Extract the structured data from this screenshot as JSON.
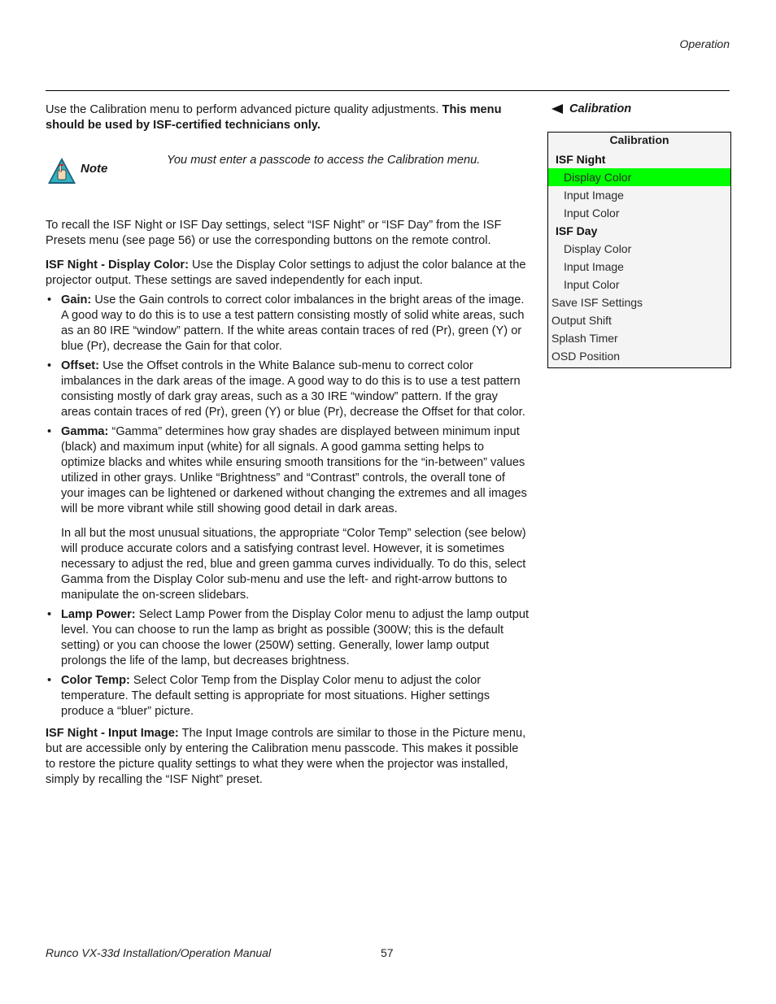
{
  "header": {
    "section": "Operation"
  },
  "intro": {
    "text": "Use the Calibration menu to perform advanced picture quality adjustments. ",
    "bold": "This menu should be used by ISF-certified technicians only."
  },
  "note": {
    "icon": "warning-hand-icon",
    "label": "Note",
    "text": "You must enter a passcode to access the Calibration menu."
  },
  "paragraphs": {
    "recall": "To recall the ISF Night or ISF Day settings, select “ISF Night” or “ISF Day” from the ISF Presets menu (see page 56) or use the corresponding buttons on the remote control.",
    "display_color": {
      "bold": "ISF Night - Display Color:",
      "text": " Use the Display Color settings to adjust the color balance at the projector output. These settings are saved independently for each input."
    },
    "input_image": {
      "bold": "ISF Night - Input Image:",
      "text": " The Input Image controls are similar to those in the Picture menu, but are accessible only by entering the Calibration menu passcode. This makes it possible to restore the picture quality settings to what they were when the projector was installed, simply by recalling the “ISF Night” preset."
    }
  },
  "bullets": [
    {
      "bold": "Gain:",
      "text": " Use the Gain controls to correct color imbalances in the bright areas of the image. A good way to do this is to use a test pattern consisting mostly of solid white areas, such as an 80 IRE “window” pattern. If the white areas contain traces of red (Pr), green (Y) or blue (Pr), decrease the Gain for that color."
    },
    {
      "bold": "Offset:",
      "text": " Use the Offset controls in the White Balance sub-menu to correct color imbalances in the dark areas of the image. A good way to do this is to use a test pattern consisting mostly of dark gray areas, such as a 30 IRE “window” pattern. If the gray areas contain traces of red (Pr), green (Y) or blue (Pr), decrease the Offset for that color."
    },
    {
      "bold": "Gamma:",
      "text": " “Gamma” determines how gray shades are displayed between minimum input (black) and maximum input (white) for all signals. A good gamma setting helps to optimize blacks and whites while ensuring smooth transitions for the “in-between” values utilized in other grays. Unlike “Brightness” and “Contrast” controls, the overall tone of your images can be lightened or darkened without changing the extremes and all images will be more vibrant while still showing good detail in dark areas.",
      "extra": "In all but the most unusual situations, the appropriate “Color Temp” selection (see below) will produce accurate colors and a satisfying contrast level. However, it is sometimes necessary to adjust the red, blue and green gamma curves individually. To do this, select Gamma from the Display Color sub-menu and use the left- and right-arrow buttons to manipulate the on-screen slidebars."
    },
    {
      "bold": "Lamp Power:",
      "text": " Select Lamp Power from the Display Color menu to adjust the lamp output level. You can choose to run the lamp as bright as possible (300W; this is the default setting) or you can choose the lower (250W) setting. Generally, lower lamp output prolongs the life of the lamp, but decreases brightness."
    },
    {
      "bold": "Color Temp:",
      "text": " Select Color Temp from the Display Color menu to adjust the color temperature. The default setting is appropriate for most situations. Higher settings produce a “bluer” picture."
    }
  ],
  "sidebar": {
    "heading": "Calibration",
    "heading_icon": "left-arrow-icon",
    "menu": {
      "title": "Calibration",
      "highlight_color": "#00ff00",
      "items": [
        {
          "label": "ISF Night",
          "type": "group"
        },
        {
          "label": "Display Color",
          "type": "sub",
          "selected": true
        },
        {
          "label": "Input Image",
          "type": "sub"
        },
        {
          "label": "Input Color",
          "type": "sub"
        },
        {
          "label": "ISF Day",
          "type": "group"
        },
        {
          "label": "Display Color",
          "type": "sub"
        },
        {
          "label": "Input Image",
          "type": "sub"
        },
        {
          "label": "Input Color",
          "type": "sub"
        },
        {
          "label": "Save ISF Settings",
          "type": "item"
        },
        {
          "label": "Output Shift",
          "type": "item"
        },
        {
          "label": "Splash Timer",
          "type": "item"
        },
        {
          "label": "OSD Position",
          "type": "item"
        }
      ]
    }
  },
  "footer": {
    "title": "Runco VX-33d Installation/Operation Manual",
    "page": "57"
  }
}
